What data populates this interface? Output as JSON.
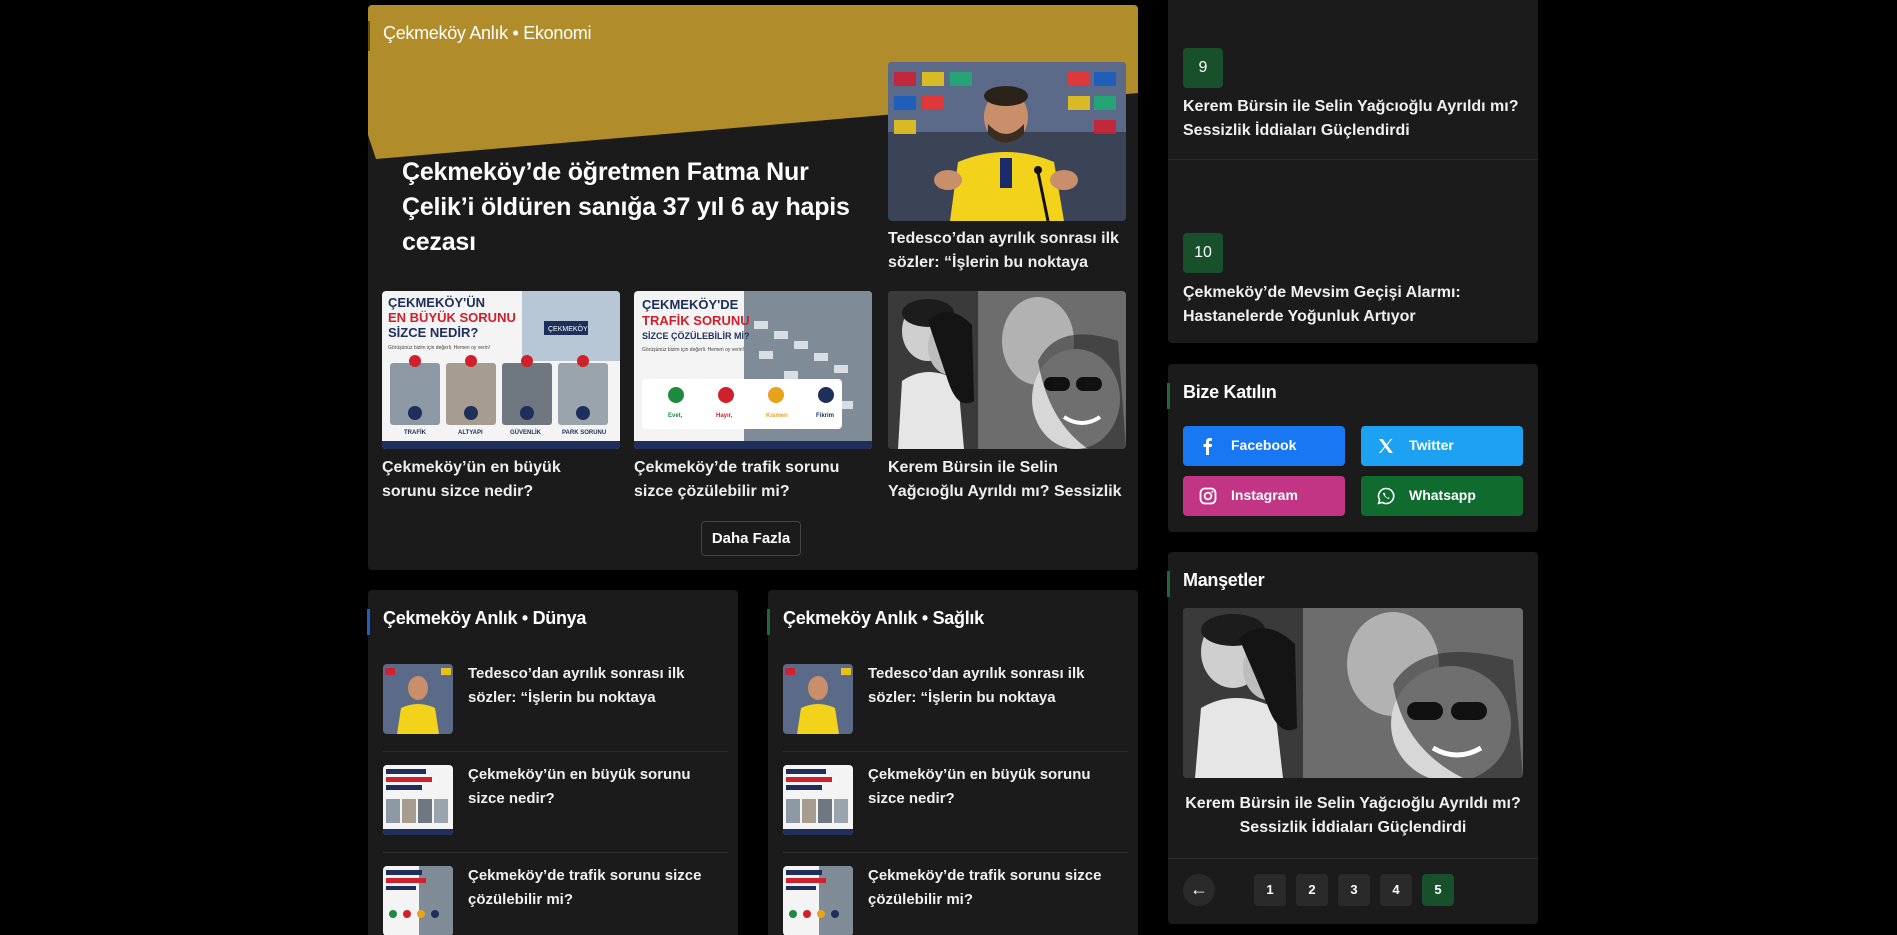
{
  "economy": {
    "title": "Çekmeköy Anlık • Ekonomi",
    "headline": "Çekmeköy’de öğretmen Fatma Nur Çelik’i öldüren sanığa 37 yıl 6 ay hapis cezası",
    "side_caption": "Tedesco’dan ayrılık sonrası ilk sözler: “İşlerin bu noktaya gelmesi…",
    "cards": [
      {
        "caption": "Çekmeköy’ün en büyük sorunu sizce nedir?",
        "img_lines": [
          "ÇEKMEKÖY'ÜN",
          "EN BÜYÜK SORUNU",
          "SİZCE NEDİR?"
        ],
        "img_sub": "Görüşünüz bizim için değerli. Hemen oy verin!",
        "img_badge": "ÇEKMEKÖY",
        "img_items": [
          "TRAFİK",
          "ALTYAPI",
          "GÜVENLİK",
          "PARK SORUNU"
        ]
      },
      {
        "caption": "Çekmeköy’de trafik sorunu sizce çözülebilir mi?",
        "img_lines": [
          "ÇEKMEKÖY'DE",
          "TRAFİK SORUNU",
          "SİZCE ÇÖZÜLEBİLİR Mİ?"
        ],
        "img_sub": "Görüşünüz bizim için değerli. Hemen oy verin!",
        "img_options": [
          "Evet,",
          "Hayır,",
          "Kısmen",
          "Fikrim"
        ]
      },
      {
        "caption": "Kerem Bürsin ile Selin Yağcıoğlu Ayrıldı mı? Sessizlik İddiaları Güçlendirdi"
      }
    ],
    "more_label": "Daha Fazla"
  },
  "world": {
    "title": "Çekmeköy Anlık • Dünya",
    "items": [
      "Tedesco’dan ayrılık sonrası ilk sözler: “İşlerin bu noktaya gelmesi…",
      "Çekmeköy’ün en büyük sorunu sizce nedir?",
      "Çekmeköy’de trafik sorunu sizce çözülebilir mi?"
    ]
  },
  "health": {
    "title": "Çekmeköy Anlık • Sağlık",
    "items": [
      "Tedesco’dan ayrılık sonrası ilk sözler: “İşlerin bu noktaya gelmesi…",
      "Çekmeköy’ün en büyük sorunu sizce nedir?",
      "Çekmeköy’de trafik sorunu sizce çözülebilir mi?"
    ]
  },
  "trending": [
    {
      "rank": "9",
      "text": "Kerem Bürsin ile Selin Yağcıoğlu Ayrıldı mı? Sessizlik İddiaları Güçlendirdi"
    },
    {
      "rank": "10",
      "text": "Çekmeköy’de Mevsim Geçişi Alarmı: Hastanelerde Yoğunluk Artıyor"
    }
  ],
  "join": {
    "title": "Bize Katılın",
    "buttons": [
      {
        "label": "Facebook",
        "color": "#1877f2"
      },
      {
        "label": "Twitter",
        "color": "#1da1f2"
      },
      {
        "label": "Instagram",
        "color": "#c13584"
      },
      {
        "label": "Whatsapp",
        "color": "#0f6b2e"
      }
    ]
  },
  "headlines": {
    "title": "Manşetler",
    "caption": "Kerem Bürsin ile Selin Yağcıoğlu Ayrıldı mı? Sessizlik İddiaları Güçlendirdi",
    "pages": [
      "1",
      "2",
      "3",
      "4",
      "5"
    ],
    "active_page": "5",
    "prev_label": "←"
  },
  "colors": {
    "gold": "#b08d2a",
    "world_accent": "#1f5fbf",
    "health_accent": "#1e6a35",
    "rank_bg": "#17502a"
  }
}
